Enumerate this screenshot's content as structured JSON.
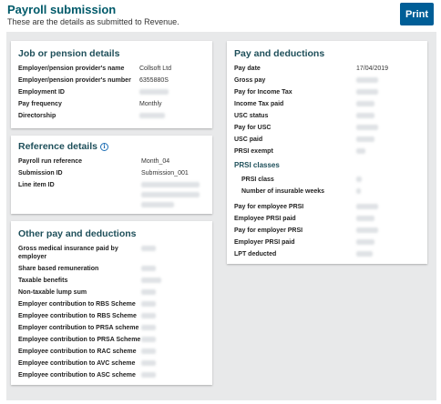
{
  "header": {
    "title": "Payroll submission",
    "subtitle": "These are the details as submitted to Revenue.",
    "print_label": "Print"
  },
  "job": {
    "heading": "Job or pension details",
    "rows": [
      {
        "label": "Employer/pension provider's name",
        "value": "Collsoft Ltd"
      },
      {
        "label": "Employer/pension provider's number",
        "value": "6355880S"
      },
      {
        "label": "Employment ID",
        "value": ""
      },
      {
        "label": "Pay frequency",
        "value": "Monthly"
      },
      {
        "label": "Directorship",
        "value": ""
      }
    ]
  },
  "reference": {
    "heading": "Reference details",
    "rows": [
      {
        "label": "Payroll run reference",
        "value": "Month_04"
      },
      {
        "label": "Submission ID",
        "value": "Submission_001"
      },
      {
        "label": "Line item ID",
        "value": ""
      }
    ]
  },
  "other": {
    "heading": "Other pay and deductions",
    "rows": [
      {
        "label": "Gross medical insurance paid by employer",
        "value": ""
      },
      {
        "label": "Share based remuneration",
        "value": ""
      },
      {
        "label": "Taxable benefits",
        "value": ""
      },
      {
        "label": "Non-taxable lump sum",
        "value": ""
      },
      {
        "label": "Employer contribution to RBS Scheme",
        "value": ""
      },
      {
        "label": "Employee contribution to RBS Scheme",
        "value": ""
      },
      {
        "label": "Employer contribution to PRSA scheme",
        "value": ""
      },
      {
        "label": "Employee contribution to PRSA Scheme",
        "value": ""
      },
      {
        "label": "Employee contribution to RAC scheme",
        "value": ""
      },
      {
        "label": "Employee contribution to AVC scheme",
        "value": ""
      },
      {
        "label": "Employee contribution to ASC scheme",
        "value": ""
      }
    ]
  },
  "pay": {
    "heading": "Pay and deductions",
    "rows": [
      {
        "label": "Pay date",
        "value": "17/04/2019"
      },
      {
        "label": "Gross pay",
        "value": ""
      },
      {
        "label": "Pay for Income Tax",
        "value": ""
      },
      {
        "label": "Income Tax paid",
        "value": ""
      },
      {
        "label": "USC status",
        "value": ""
      },
      {
        "label": "Pay for USC",
        "value": ""
      },
      {
        "label": "USC paid",
        "value": ""
      },
      {
        "label": "PRSI exempt",
        "value": ""
      }
    ],
    "prsi_heading": "PRSI classes",
    "prsi_rows": [
      {
        "label": "PRSI class",
        "value": ""
      },
      {
        "label": "Number of insurable weeks",
        "value": ""
      }
    ],
    "rows2": [
      {
        "label": "Pay for employee PRSI",
        "value": ""
      },
      {
        "label": "Employee PRSI paid",
        "value": ""
      },
      {
        "label": "Pay for employer PRSI",
        "value": ""
      },
      {
        "label": "Employer PRSI paid",
        "value": ""
      },
      {
        "label": "LPT deducted",
        "value": ""
      }
    ]
  }
}
